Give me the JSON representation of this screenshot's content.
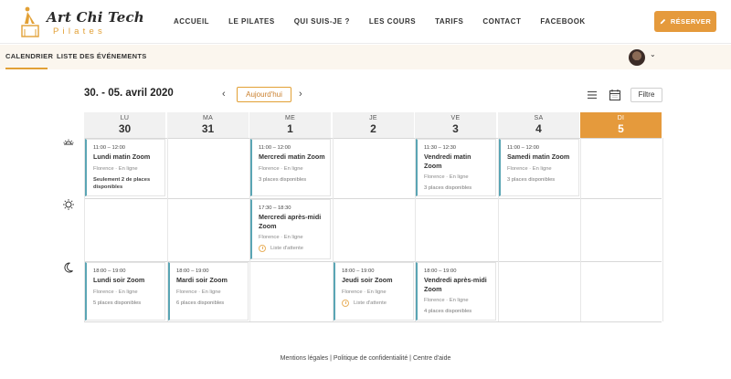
{
  "brand": {
    "title": "Art Chi Tech",
    "subtitle": "Pilates",
    "accent": "#e2a035"
  },
  "nav": [
    "ACCUEIL",
    "LE PILATES",
    "QUI SUIS-JE ?",
    "LES COURS",
    "TARIFS",
    "CONTACT",
    "FACEBOOK"
  ],
  "reserve": {
    "icon": "pencil-icon",
    "label": "RÉSERVER",
    "color": "#e59a3c"
  },
  "subnav": {
    "tabs": [
      "CALENDRIER",
      "LISTE DES ÉVÉNEMENTS"
    ],
    "active": 0
  },
  "toolbar": {
    "date_range": "30. - 05. avril 2020",
    "today": "Aujourd'hui",
    "filter": "Filtre",
    "views": [
      "list-view-icon",
      "calendar-view-icon"
    ]
  },
  "days": [
    {
      "abbr": "LU",
      "num": "30",
      "today": false
    },
    {
      "abbr": "MA",
      "num": "31",
      "today": false
    },
    {
      "abbr": "ME",
      "num": "1",
      "today": false
    },
    {
      "abbr": "JE",
      "num": "2",
      "today": false
    },
    {
      "abbr": "VE",
      "num": "3",
      "today": false
    },
    {
      "abbr": "SA",
      "num": "4",
      "today": false
    },
    {
      "abbr": "DI",
      "num": "5",
      "today": true
    }
  ],
  "periods": [
    "morning-sun-icon",
    "afternoon-sun-icon",
    "evening-moon-icon"
  ],
  "events": [
    {
      "day": 0,
      "period": 0,
      "time": "11:00 – 12:00",
      "title": "Lundi matin Zoom",
      "location": "Florence · En ligne",
      "places": "Seulement 2 de places disponibles",
      "status": "warn"
    },
    {
      "day": 2,
      "period": 0,
      "time": "11:00 – 12:00",
      "title": "Mercredi matin Zoom",
      "location": "Florence · En ligne",
      "places": "3 places disponibles",
      "status": "ok"
    },
    {
      "day": 4,
      "period": 0,
      "time": "11:30 – 12:30",
      "title": "Vendredi matin Zoom",
      "location": "Florence · En ligne",
      "places": "3 places disponibles",
      "status": "ok"
    },
    {
      "day": 5,
      "period": 0,
      "time": "11:00 – 12:00",
      "title": "Samedi matin Zoom",
      "location": "Florence · En ligne",
      "places": "3 places disponibles",
      "status": "ok"
    },
    {
      "day": 2,
      "period": 1,
      "time": "17:30 – 18:30",
      "title": "Mercredi après-midi Zoom",
      "location": "Florence · En ligne",
      "places": "Liste d'attente",
      "status": "wait"
    },
    {
      "day": 0,
      "period": 2,
      "time": "18:00 – 19:00",
      "title": "Lundi soir Zoom",
      "location": "Florence · En ligne",
      "places": "5 places disponibles",
      "status": "ok"
    },
    {
      "day": 1,
      "period": 2,
      "time": "18:00 – 19:00",
      "title": "Mardi soir Zoom",
      "location": "Florence · En ligne",
      "places": "6 places disponibles",
      "status": "ok"
    },
    {
      "day": 3,
      "period": 2,
      "time": "18:00 – 19:00",
      "title": "Jeudi soir Zoom",
      "location": "Florence · En ligne",
      "places": "Liste d'attente",
      "status": "wait"
    },
    {
      "day": 4,
      "period": 2,
      "time": "18:00 – 19:00",
      "title": "Vendredi après-midi Zoom",
      "location": "Florence · En ligne",
      "places": "4 places disponibles",
      "status": "ok"
    }
  ],
  "footer": {
    "links": [
      "Mentions légales",
      "Politique de confidentialité",
      "Centre d'aide"
    ],
    "separator": "|"
  }
}
